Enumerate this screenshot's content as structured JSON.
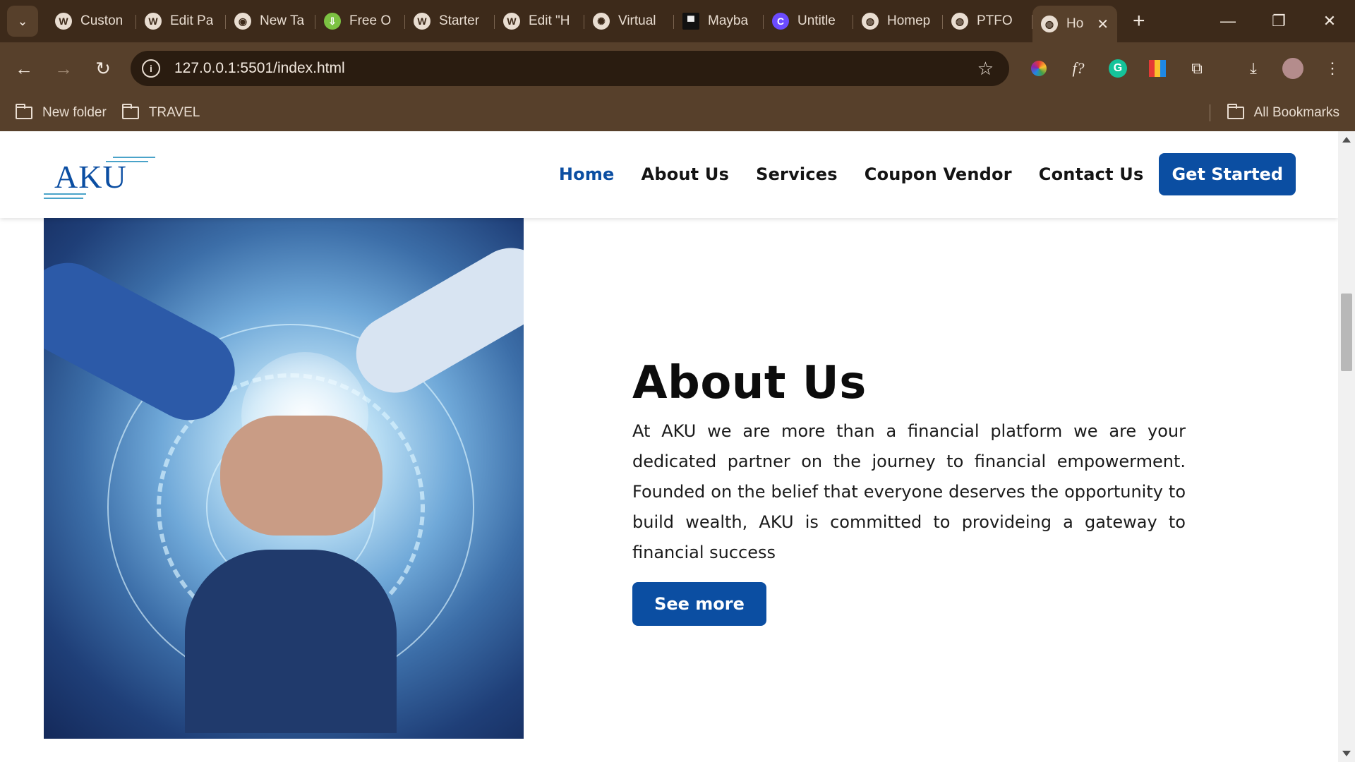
{
  "browser": {
    "tabs": [
      {
        "title": "Custon",
        "icon": "wordpress-icon"
      },
      {
        "title": "Edit Pa",
        "icon": "wordpress-icon"
      },
      {
        "title": "New Ta",
        "icon": "chrome-icon"
      },
      {
        "title": "Free O",
        "icon": "download-arrow-icon"
      },
      {
        "title": "Starter",
        "icon": "wordpress-icon"
      },
      {
        "title": "Edit \"H",
        "icon": "wordpress-icon"
      },
      {
        "title": "Virtual",
        "icon": "openai-icon"
      },
      {
        "title": "Mayba",
        "icon": "unsplash-icon"
      },
      {
        "title": "Untitle",
        "icon": "canva-icon"
      },
      {
        "title": "Homep",
        "icon": "globe-icon"
      },
      {
        "title": "PTFO",
        "icon": "globe-icon"
      }
    ],
    "active_tab": {
      "title": "Ho",
      "icon": "globe-icon"
    },
    "url": "127.0.0.1:5501/index.html",
    "bookmarks": [
      "New folder",
      "TRAVEL"
    ],
    "all_bookmarks": "All Bookmarks"
  },
  "site": {
    "logo": "AKU",
    "nav": [
      "Home",
      "About Us",
      "Services",
      "Coupon Vendor",
      "Contact Us"
    ],
    "cta": "Get Started",
    "brand_color": "#0b4ea2"
  },
  "about": {
    "heading": "About Us",
    "body": "At AKU we are more than a financial platform we are your dedicated partner on the journey to financial empowerment. Founded on the belief that everyone deserves the opportunity to build wealth, AKU is committed to provideing a gateway to financial success",
    "button": "See more"
  }
}
